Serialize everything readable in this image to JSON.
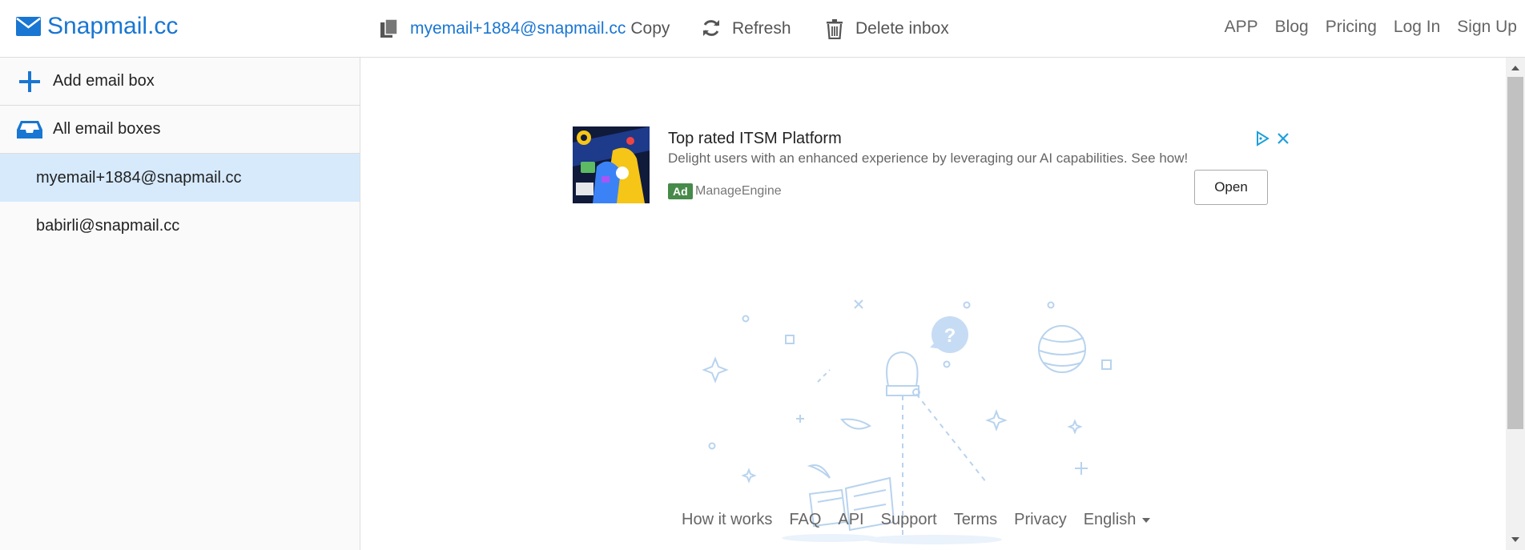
{
  "header": {
    "brand": "Snapmail.cc",
    "current_email": "myemail+1884@snapmail.cc",
    "copy_label": "Copy",
    "refresh_label": "Refresh",
    "delete_label": "Delete inbox",
    "nav": [
      "APP",
      "Blog",
      "Pricing",
      "Log In",
      "Sign Up"
    ]
  },
  "sidebar": {
    "add_label": "Add email box",
    "all_label": "All email boxes",
    "emails": [
      "myemail+1884@snapmail.cc",
      "babirli@snapmail.cc"
    ],
    "active_index": 0
  },
  "ad": {
    "title": "Top rated ITSM Platform",
    "description": "Delight users with an enhanced experience by leveraging our AI capabilities. See how!",
    "badge": "Ad",
    "advertiser": "ManageEngine",
    "cta": "Open"
  },
  "footer": {
    "links": [
      "How it works",
      "FAQ",
      "API",
      "Support",
      "Terms",
      "Privacy"
    ],
    "language": "English"
  },
  "colors": {
    "brand": "#1976d2",
    "active_row": "#d6eafc",
    "sidebar_bg": "#fafafa",
    "ad_badge": "#478a4a",
    "illustration": "#b8d3ee"
  }
}
